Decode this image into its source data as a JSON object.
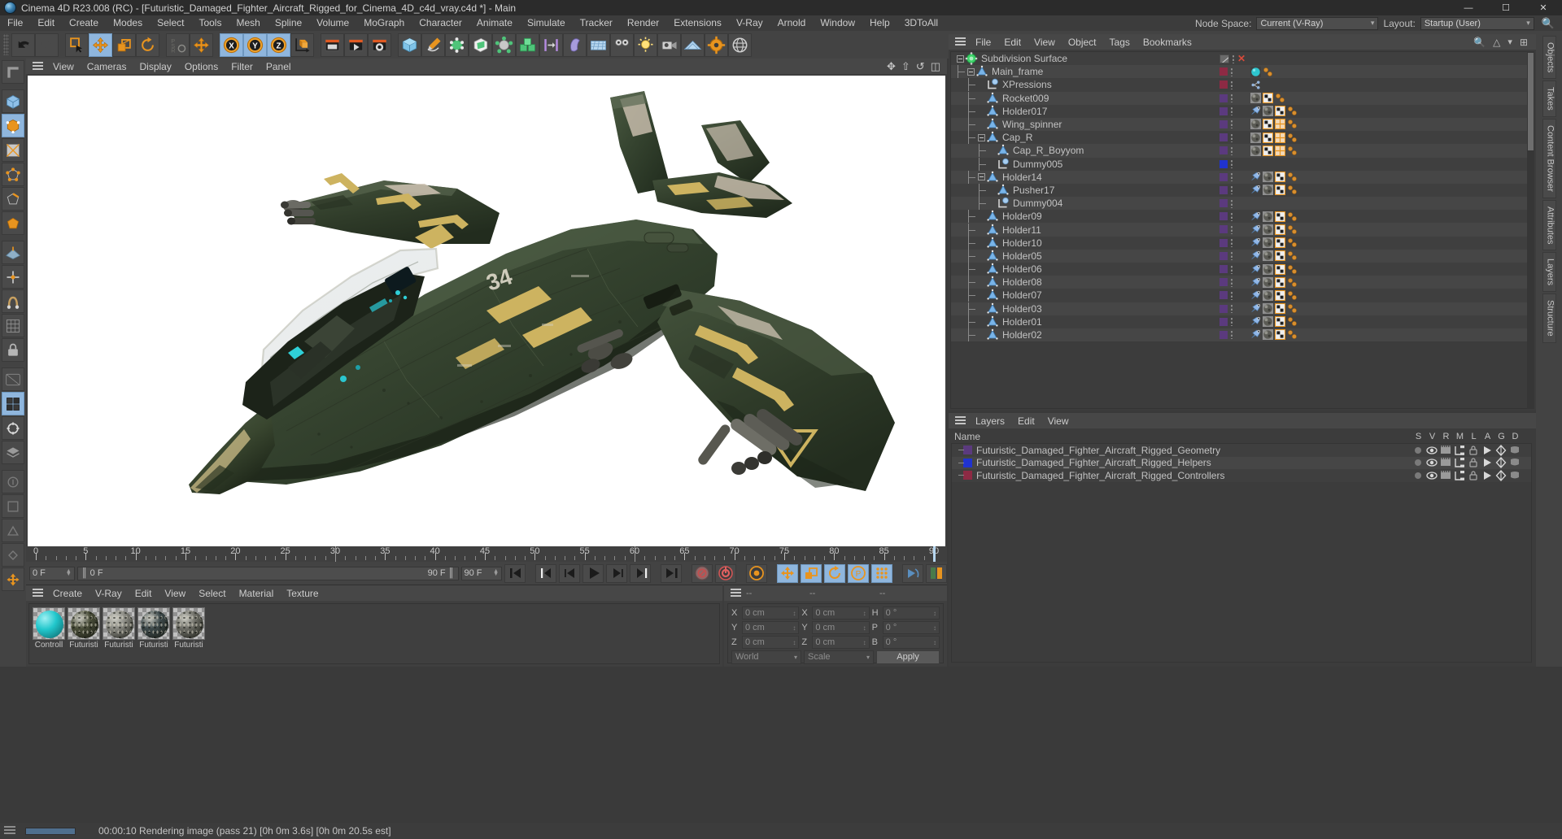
{
  "window": {
    "title": "Cinema 4D R23.008 (RC) - [Futuristic_Damaged_Fighter_Aircraft_Rigged_for_Cinema_4D_c4d_vray.c4d *] - Main",
    "minimize": "—",
    "maximize": "☐",
    "close": "✕"
  },
  "menubar": {
    "items": [
      "File",
      "Edit",
      "Create",
      "Modes",
      "Select",
      "Tools",
      "Mesh",
      "Spline",
      "Volume",
      "MoGraph",
      "Character",
      "Animate",
      "Simulate",
      "Tracker",
      "Render",
      "Extensions",
      "V-Ray",
      "Arnold",
      "Window",
      "Help",
      "3DToAll"
    ],
    "node_space_label": "Node Space:",
    "node_space_value": "Current (V-Ray)",
    "layout_label": "Layout:",
    "layout_value": "Startup (User)"
  },
  "viewport": {
    "menu": [
      "View",
      "Cameras",
      "Display",
      "Options",
      "Filter",
      "Panel"
    ],
    "icons": [
      "move-icon",
      "scale-icon",
      "rotate-icon",
      "panel-icon"
    ]
  },
  "timeline": {
    "ticks": [
      0,
      5,
      10,
      15,
      20,
      25,
      30,
      35,
      40,
      45,
      50,
      55,
      60,
      65,
      70,
      75,
      80,
      85,
      90
    ],
    "current_frame": "0 F",
    "range_start": "0 F",
    "range_end": "90 F",
    "end_frame": "90 F",
    "playhead_frame": 90,
    "marker_frames": [
      30,
      60
    ]
  },
  "material_manager": {
    "menu": [
      "Create",
      "V-Ray",
      "Edit",
      "View",
      "Select",
      "Material",
      "Texture"
    ],
    "materials": [
      {
        "name": "Controll",
        "color": "#21c7cc",
        "type": "solid"
      },
      {
        "name": "Futuristi",
        "color": "#4a4e3a",
        "type": "texture"
      },
      {
        "name": "Futuristi",
        "color": "#8b8b84",
        "type": "texture"
      },
      {
        "name": "Futuristi",
        "color": "#3e4a4c",
        "type": "texture"
      },
      {
        "name": "Futuristi",
        "color": "#6f6f68",
        "type": "texture"
      }
    ]
  },
  "coordinates": {
    "header": [
      "--",
      "--",
      "--"
    ],
    "rows": [
      {
        "l1": "X",
        "v1": "0 cm",
        "l2": "X",
        "v2": "0 cm",
        "l3": "H",
        "v3": "0 °"
      },
      {
        "l1": "Y",
        "v1": "0 cm",
        "l2": "Y",
        "v2": "0 cm",
        "l3": "P",
        "v3": "0 °"
      },
      {
        "l1": "Z",
        "v1": "0 cm",
        "l2": "Z",
        "v2": "0 cm",
        "l3": "B",
        "v3": "0 °"
      }
    ],
    "system": "World",
    "mode": "Scale",
    "apply": "Apply"
  },
  "object_manager": {
    "menu": [
      "File",
      "Edit",
      "View",
      "Object",
      "Tags",
      "Bookmarks"
    ],
    "items": [
      {
        "name": "Subdivision Surface",
        "depth": 0,
        "icon": "subdivision-surface-icon",
        "expander": "minus",
        "color": "",
        "tags": [],
        "special": "cross"
      },
      {
        "name": "Main_frame",
        "depth": 1,
        "icon": "null-object-icon",
        "expander": "minus",
        "color": "#8d2a44",
        "tags": [
          "material-teal",
          "xpresso-dots"
        ]
      },
      {
        "name": "XPressions",
        "depth": 2,
        "icon": "xpresso-icon",
        "expander": "",
        "color": "#8d2a44",
        "tags": [
          "xpresso-node"
        ]
      },
      {
        "name": "Rocket009",
        "depth": 2,
        "icon": "null-object-icon",
        "expander": "",
        "color": "#5b3a7e",
        "tags": [
          "material-dark",
          "uvw-icon",
          "xpresso-dots"
        ]
      },
      {
        "name": "Holder017",
        "depth": 2,
        "icon": "null-object-icon",
        "expander": "",
        "color": "#5b3a7e",
        "tags": [
          "pin-icon",
          "material-dark",
          "uvw-icon",
          "xpresso-dots"
        ]
      },
      {
        "name": "Wing_spinner",
        "depth": 2,
        "icon": "null-object-icon",
        "expander": "",
        "color": "#5b3a7e",
        "tags": [
          "material-dark",
          "uvw-icon",
          "tex-icon",
          "xpresso-dots"
        ]
      },
      {
        "name": "Cap_R",
        "depth": 2,
        "icon": "null-object-icon",
        "expander": "minus",
        "color": "#5b3a7e",
        "tags": [
          "material-dark",
          "uvw-icon",
          "tex-icon",
          "xpresso-dots"
        ]
      },
      {
        "name": "Cap_R_Boyyom",
        "depth": 3,
        "icon": "null-object-icon",
        "expander": "",
        "color": "#5b3a7e",
        "tags": [
          "material-dark",
          "uvw-icon",
          "tex-icon",
          "xpresso-dots"
        ]
      },
      {
        "name": "Dummy005",
        "depth": 3,
        "icon": "xpresso-icon",
        "expander": "",
        "color": "#2033cf",
        "tags": []
      },
      {
        "name": "Holder14",
        "depth": 2,
        "icon": "null-object-icon",
        "expander": "minus",
        "color": "#5b3a7e",
        "tags": [
          "pin-icon",
          "material-dark",
          "uvw-icon",
          "xpresso-dots"
        ]
      },
      {
        "name": "Pusher17",
        "depth": 3,
        "icon": "null-object-icon",
        "expander": "",
        "color": "#5b3a7e",
        "tags": [
          "pin-icon",
          "material-dark",
          "uvw-icon",
          "xpresso-dots"
        ]
      },
      {
        "name": "Dummy004",
        "depth": 3,
        "icon": "xpresso-icon",
        "expander": "",
        "color": "#5b3a7e",
        "tags": []
      },
      {
        "name": "Holder09",
        "depth": 2,
        "icon": "null-object-icon",
        "expander": "",
        "color": "#5b3a7e",
        "tags": [
          "pin-icon",
          "material-dark",
          "uvw-icon",
          "xpresso-dots"
        ]
      },
      {
        "name": "Holder11",
        "depth": 2,
        "icon": "null-object-icon",
        "expander": "",
        "color": "#5b3a7e",
        "tags": [
          "pin-icon",
          "material-dark",
          "uvw-icon",
          "xpresso-dots"
        ]
      },
      {
        "name": "Holder10",
        "depth": 2,
        "icon": "null-object-icon",
        "expander": "",
        "color": "#5b3a7e",
        "tags": [
          "pin-icon",
          "material-dark",
          "uvw-icon",
          "xpresso-dots"
        ]
      },
      {
        "name": "Holder05",
        "depth": 2,
        "icon": "null-object-icon",
        "expander": "",
        "color": "#5b3a7e",
        "tags": [
          "pin-icon",
          "material-dark",
          "uvw-icon",
          "xpresso-dots"
        ]
      },
      {
        "name": "Holder06",
        "depth": 2,
        "icon": "null-object-icon",
        "expander": "",
        "color": "#5b3a7e",
        "tags": [
          "pin-icon",
          "material-dark",
          "uvw-icon",
          "xpresso-dots"
        ]
      },
      {
        "name": "Holder08",
        "depth": 2,
        "icon": "null-object-icon",
        "expander": "",
        "color": "#5b3a7e",
        "tags": [
          "pin-icon",
          "material-dark",
          "uvw-icon",
          "xpresso-dots"
        ]
      },
      {
        "name": "Holder07",
        "depth": 2,
        "icon": "null-object-icon",
        "expander": "",
        "color": "#5b3a7e",
        "tags": [
          "pin-icon",
          "material-dark",
          "uvw-icon",
          "xpresso-dots"
        ]
      },
      {
        "name": "Holder03",
        "depth": 2,
        "icon": "null-object-icon",
        "expander": "",
        "color": "#5b3a7e",
        "tags": [
          "pin-icon",
          "material-dark",
          "uvw-icon",
          "xpresso-dots"
        ]
      },
      {
        "name": "Holder01",
        "depth": 2,
        "icon": "null-object-icon",
        "expander": "",
        "color": "#5b3a7e",
        "tags": [
          "pin-icon",
          "material-dark",
          "uvw-icon",
          "xpresso-dots"
        ]
      },
      {
        "name": "Holder02",
        "depth": 2,
        "icon": "null-object-icon",
        "expander": "",
        "color": "#5b3a7e",
        "tags": [
          "pin-icon",
          "material-dark",
          "uvw-icon",
          "xpresso-dots"
        ]
      }
    ]
  },
  "layer_manager": {
    "menu": [
      "Layers",
      "Edit",
      "View"
    ],
    "name_header": "Name",
    "columns": [
      "S",
      "V",
      "R",
      "M",
      "L",
      "A",
      "G",
      "D"
    ],
    "rows": [
      {
        "name": "Futuristic_Damaged_Fighter_Aircraft_Rigged_Geometry",
        "color": "#5b3a7e"
      },
      {
        "name": "Futuristic_Damaged_Fighter_Aircraft_Rigged_Helpers",
        "color": "#2033cf"
      },
      {
        "name": "Futuristic_Damaged_Fighter_Aircraft_Rigged_Controllers",
        "color": "#8d2a44"
      }
    ]
  },
  "right_dock": {
    "tabs": [
      "Objects",
      "Takes",
      "Content Browser",
      "Attributes",
      "Layers",
      "Structure"
    ]
  },
  "status": {
    "text": "00:00:10 Rendering image (pass 21) [0h  0m  3.6s] [0h  0m 20.5s est]"
  },
  "toolbar": {
    "groups": [
      {
        "buttons": [
          {
            "name": "undo-icon",
            "selected": false
          },
          {
            "name": "redo-icon",
            "selected": false
          }
        ]
      },
      {
        "buttons": [
          {
            "name": "live-selection-icon",
            "selected": false
          },
          {
            "name": "move-tool-icon",
            "selected": true
          },
          {
            "name": "scale-tool-icon",
            "selected": false
          },
          {
            "name": "rotate-tool-icon",
            "selected": false
          }
        ]
      },
      {
        "buttons": [
          {
            "name": "psr-icon",
            "selected": false
          },
          {
            "name": "world-axis-icon",
            "selected": false
          }
        ]
      },
      {
        "buttons": [
          {
            "name": "x-axis-lock-icon",
            "selected": true
          },
          {
            "name": "y-axis-lock-icon",
            "selected": true
          },
          {
            "name": "z-axis-lock-icon",
            "selected": true
          },
          {
            "name": "world-object-axis-icon",
            "selected": false
          }
        ]
      },
      {
        "buttons": [
          {
            "name": "render-view-icon",
            "selected": false
          },
          {
            "name": "render-to-picture-viewer-icon",
            "selected": false
          },
          {
            "name": "render-settings-icon",
            "selected": false
          }
        ]
      },
      {
        "buttons": [
          {
            "name": "cube-primitive-icon",
            "selected": false
          },
          {
            "name": "spline-pen-icon",
            "selected": false
          },
          {
            "name": "generator-icon",
            "selected": false
          },
          {
            "name": "deformer-icon",
            "selected": false
          },
          {
            "name": "scene-object-icon",
            "selected": false
          },
          {
            "name": "mograph-cloner-icon",
            "selected": false
          },
          {
            "name": "field-icon",
            "selected": false
          },
          {
            "name": "character-object-icon",
            "selected": false
          },
          {
            "name": "simulation-icon",
            "selected": false
          },
          {
            "name": "motion-tracker-icon",
            "selected": false
          },
          {
            "name": "light-icon",
            "selected": false
          },
          {
            "name": "camera-icon",
            "selected": false
          },
          {
            "name": "floor-icon",
            "selected": false
          },
          {
            "name": "plugin-icon",
            "selected": false
          },
          {
            "name": "web-icon",
            "selected": false
          }
        ]
      }
    ]
  },
  "left_toolbar": {
    "buttons": [
      {
        "name": "viewport-corner-icon",
        "selected": false
      },
      {
        "name": "model-mode-icon",
        "selected": false
      },
      {
        "name": "object-mode-icon",
        "selected": true
      },
      {
        "name": "texture-mode-icon",
        "selected": false
      },
      {
        "name": "point-mode-icon",
        "selected": false
      },
      {
        "name": "edge-mode-icon",
        "selected": false
      },
      {
        "name": "polygon-mode-icon",
        "selected": false
      },
      {
        "name": "workplane-icon",
        "selected": false
      },
      {
        "name": "enable-axis-icon",
        "selected": false
      },
      {
        "name": "snap-icon",
        "selected": false
      },
      {
        "name": "quantize-icon",
        "selected": false
      },
      {
        "name": "workplane-lock-icon",
        "selected": false
      },
      {
        "name": "viewport-solo-icon",
        "selected": false
      },
      {
        "name": "viewport-filter-icon",
        "selected": true
      },
      {
        "name": "render-region-icon",
        "selected": false
      },
      {
        "name": "layer-icon",
        "selected": false
      },
      {
        "name": "extra-a-icon",
        "selected": false
      },
      {
        "name": "extra-b-icon",
        "selected": false
      },
      {
        "name": "extra-c-icon",
        "selected": false
      },
      {
        "name": "extra-d-icon",
        "selected": false
      },
      {
        "name": "extra-e-icon",
        "selected": false
      }
    ]
  },
  "playback": {
    "buttons": [
      {
        "name": "go-to-start-icon",
        "selected": false
      },
      {
        "name": "go-to-previous-keyframe-icon",
        "selected": false
      },
      {
        "name": "step-back-icon",
        "selected": false
      },
      {
        "name": "play-icon",
        "selected": false
      },
      {
        "name": "step-forward-icon",
        "selected": false
      },
      {
        "name": "go-to-next-keyframe-icon",
        "selected": false
      },
      {
        "name": "go-to-end-icon",
        "selected": false
      },
      {
        "name": "record-active-objects-icon",
        "selected": false
      },
      {
        "name": "autokeying-icon",
        "selected": false
      },
      {
        "name": "keyframe-selection-icon",
        "selected": false
      },
      {
        "name": "position-key-icon",
        "selected": true
      },
      {
        "name": "scale-key-icon",
        "selected": true
      },
      {
        "name": "rotation-key-icon",
        "selected": true
      },
      {
        "name": "parameter-key-icon",
        "selected": true
      },
      {
        "name": "point-level-animation-icon",
        "selected": true
      },
      {
        "name": "motion-clip-icon",
        "selected": false
      },
      {
        "name": "timeline-icon",
        "selected": false
      }
    ]
  },
  "colors": {
    "accent_selected": "#8fb6dd",
    "orange": "#e8941f",
    "panel_bg": "#3c3c3c",
    "toolbar_bg": "#434343",
    "title_bg": "#2b2b2b",
    "text": "#c8c8c8"
  }
}
